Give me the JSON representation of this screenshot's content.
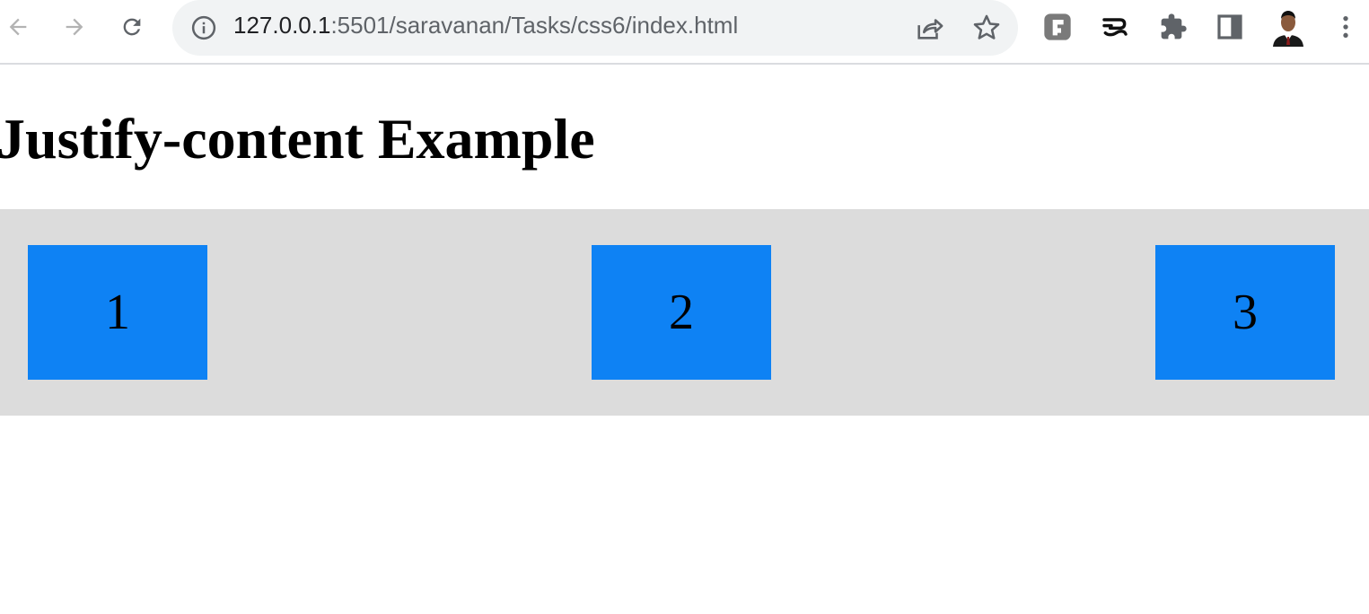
{
  "browser": {
    "url_host": "127.0.0.1",
    "url_rest": ":5501/saravanan/Tasks/css6/index.html",
    "icons": {
      "back": "back-arrow-icon",
      "forward": "forward-arrow-icon",
      "reload": "reload-icon",
      "info": "info-icon",
      "share": "share-icon",
      "bookmark": "star-icon",
      "extension1": "grid-extension-icon",
      "extension2": "tamil-extension-icon",
      "extensions": "puzzle-icon",
      "side_panel": "side-panel-icon",
      "profile": "avatar",
      "menu": "kebab-menu-icon"
    }
  },
  "page": {
    "title": "Justify-content Example",
    "items": [
      "1",
      "2",
      "3"
    ]
  },
  "colors": {
    "container_bg": "#dcdcdc",
    "item_bg": "#0e82f4"
  }
}
